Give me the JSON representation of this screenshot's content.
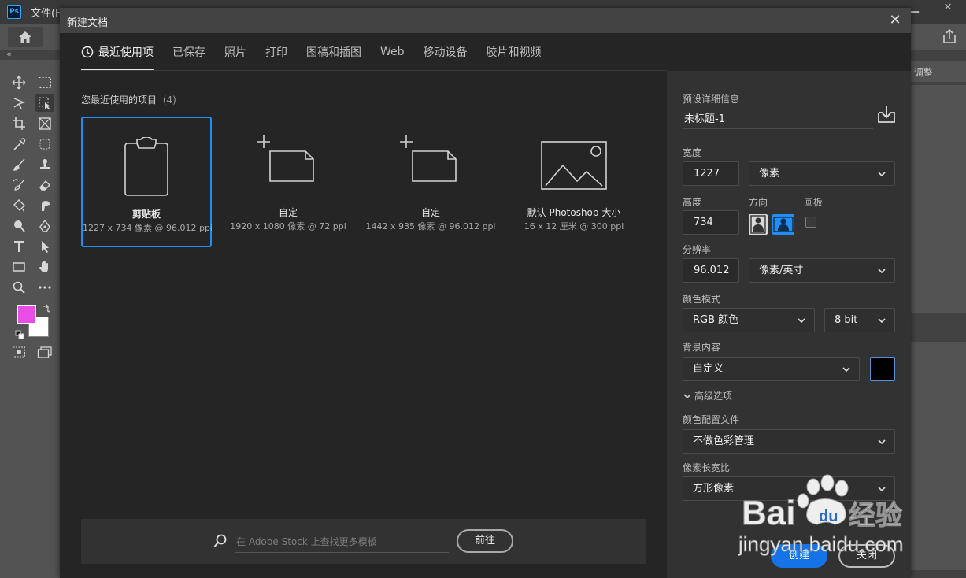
{
  "app": {
    "logo": "Ps",
    "menus": [
      "文件(F)"
    ]
  },
  "dialog": {
    "title": "新建文档",
    "tabs": [
      {
        "label": "最近使用项",
        "active": true
      },
      {
        "label": "已保存"
      },
      {
        "label": "照片"
      },
      {
        "label": "打印"
      },
      {
        "label": "图稿和插图"
      },
      {
        "label": "Web"
      },
      {
        "label": "移动设备"
      },
      {
        "label": "胶片和视频"
      }
    ],
    "recent": {
      "title": "您最近使用的项目",
      "count": "(4)",
      "items": [
        {
          "name": "剪贴板",
          "sub": "1227 x 734 像素 @ 96.012 ppi",
          "icon": "clipboard-icon",
          "selected": true
        },
        {
          "name": "自定",
          "sub": "1920 x 1080 像素 @ 72 ppi",
          "icon": "custom-document-icon"
        },
        {
          "name": "自定",
          "sub": "1442 x 935 像素 @ 96.012 ppi",
          "icon": "custom-document-icon"
        },
        {
          "name": "默认 Photoshop 大小",
          "sub": "16 x 12 厘米 @ 300 ppi",
          "icon": "image-icon"
        }
      ]
    },
    "stock": {
      "placeholder": "在 Adobe Stock 上查找更多模板",
      "go_label": "前往"
    },
    "details": {
      "section_title": "预设详细信息",
      "preset_name": "未标题-1",
      "width_label": "宽度",
      "width_value": "1227",
      "width_unit": "像素",
      "height_label": "高度",
      "height_value": "734",
      "orientation_label": "方向",
      "artboard_label": "画板",
      "resolution_label": "分辨率",
      "resolution_value": "96.012",
      "resolution_unit": "像素/英寸",
      "color_mode_label": "颜色模式",
      "color_mode_value": "RGB 颜色",
      "bit_depth_value": "8 bit",
      "bg_label": "背景内容",
      "bg_value": "自定义",
      "bg_color": "#000000",
      "advanced_label": "高级选项",
      "profile_label": "颜色配置文件",
      "profile_value": "不做色彩管理",
      "pixel_aspect_label": "像素长宽比",
      "pixel_aspect_value": "方形像素",
      "create_label": "创建",
      "close_label": "关闭"
    }
  },
  "toolbar": {
    "foreground_color": "#e84de6",
    "background_color": "#ffffff"
  },
  "right_panel": {
    "tab_label": "调整"
  },
  "watermark": {
    "brand": "Baidu经验",
    "url": "jingyan.baidu.com"
  }
}
